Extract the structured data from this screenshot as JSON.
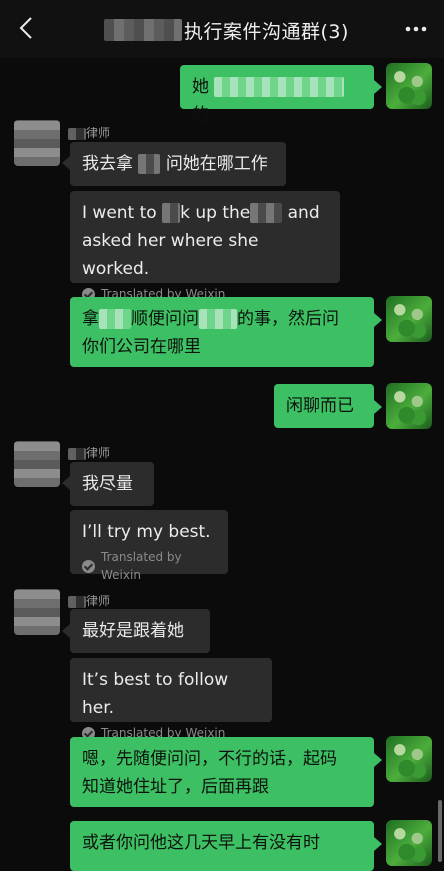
{
  "header": {
    "title_visible": "执行案件沟通群(3)"
  },
  "sender_label": "律师",
  "messages": [
    {
      "from": "me",
      "text_before": "她",
      "text_after": "的"
    },
    {
      "from": "other",
      "text_before": "我去拿",
      "text_after": "问她在哪工作"
    },
    {
      "from": "other_translation",
      "line1_before": "I went to ",
      "line1_mid": "k up the",
      "line1_after": " and",
      "line2": "asked her where she worked."
    },
    {
      "from": "me",
      "line1_a": "拿",
      "line1_b": "顺便问问",
      "line1_c": "的事，然后问",
      "line2": "你们公司在哪里"
    },
    {
      "from": "me",
      "text": "闲聊而已"
    },
    {
      "from": "other",
      "text": "我尽量"
    },
    {
      "from": "other_translation",
      "text": "I’ll try my best."
    },
    {
      "from": "other",
      "text": "最好是跟着她"
    },
    {
      "from": "other_translation",
      "text": "It’s best to follow her."
    },
    {
      "from": "me",
      "line1": "嗯，先随便问问，不行的话，起码",
      "line2": "知道她住址了，后面再跟"
    },
    {
      "from": "me",
      "text": "或者你问他这几天早上有没有时"
    }
  ],
  "translation_credit": "Translated by Weixin",
  "icons": {
    "back": "chevron-left-icon",
    "more": "more-dots-icon",
    "translated": "check-circle-icon"
  },
  "colors": {
    "me_bubble": "#3dbf63",
    "other_bubble": "#2c2c2c",
    "background": "#0b0b0b"
  }
}
